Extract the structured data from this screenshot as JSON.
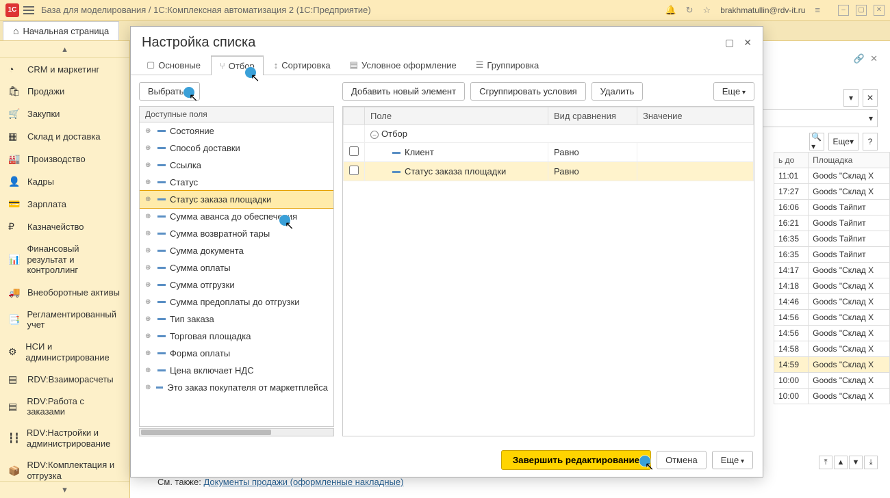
{
  "titlebar": {
    "title": "База для моделирования / 1С:Комплексная автоматизация 2  (1С:Предприятие)",
    "user": "brakhmatullin@rdv-it.ru"
  },
  "start_tab": "Начальная страница",
  "sidebar": {
    "items": [
      {
        "icon": "◔",
        "label": "CRM и маркетинг"
      },
      {
        "icon": "🛍",
        "label": "Продажи"
      },
      {
        "icon": "🛒",
        "label": "Закупки"
      },
      {
        "icon": "▦",
        "label": "Склад и доставка"
      },
      {
        "icon": "🏭",
        "label": "Производство"
      },
      {
        "icon": "👤",
        "label": "Кадры"
      },
      {
        "icon": "💳",
        "label": "Зарплата"
      },
      {
        "icon": "₽",
        "label": "Казначейство"
      },
      {
        "icon": "📊",
        "label": "Финансовый результат и контроллинг"
      },
      {
        "icon": "🚚",
        "label": "Внеоборотные активы"
      },
      {
        "icon": "📑",
        "label": "Регламентированный учет"
      },
      {
        "icon": "⚙",
        "label": "НСИ и администрирование"
      },
      {
        "icon": "▤",
        "label": "RDV:Взаиморасчеты"
      },
      {
        "icon": "▤",
        "label": "RDV:Работа с заказами"
      },
      {
        "icon": "┇┇",
        "label": "RDV:Настройки и администрирование"
      },
      {
        "icon": "📦",
        "label": "RDV:Комплектация и отгрузка"
      }
    ]
  },
  "bg_toolbar": {
    "more": "Еще",
    "help": "?"
  },
  "bg_table": {
    "headers": {
      "col1": "ь до",
      "col2": "Площадка"
    },
    "rows": [
      {
        "c1": "11:01",
        "c2": "Goods \"Склад X"
      },
      {
        "c1": "17:27",
        "c2": "Goods \"Склад X"
      },
      {
        "c1": "16:06",
        "c2": "Goods Тайпит"
      },
      {
        "c1": "16:21",
        "c2": "Goods Тайпит"
      },
      {
        "c1": "16:35",
        "c2": "Goods Тайпит"
      },
      {
        "c1": "16:35",
        "c2": "Goods Тайпит"
      },
      {
        "c1": "14:17",
        "c2": "Goods \"Склад X"
      },
      {
        "c1": "14:18",
        "c2": "Goods \"Склад X"
      },
      {
        "c1": "14:46",
        "c2": "Goods \"Склад X"
      },
      {
        "c1": "14:56",
        "c2": "Goods \"Склад X"
      },
      {
        "c1": "14:56",
        "c2": "Goods \"Склад X"
      },
      {
        "c1": "14:58",
        "c2": "Goods \"Склад X"
      },
      {
        "c1": "14:59",
        "c2": "Goods \"Склад X",
        "hl": true
      },
      {
        "c1": "10:00",
        "c2": "Goods \"Склад X"
      },
      {
        "c1": "10:00",
        "c2": "Goods \"Склад X"
      }
    ]
  },
  "footer": {
    "prefix": "См. также: ",
    "link": "Документы продажи (оформленные накладные)"
  },
  "dialog": {
    "title": "Настройка списка",
    "tabs": {
      "main": "Основные",
      "filter": "Отбор",
      "sort": "Сортировка",
      "cond": "Условное оформление",
      "group": "Группировка"
    },
    "buttons": {
      "choose": "Выбрать...",
      "add_element": "Добавить новый элемент",
      "group_cond": "Сгруппировать условия",
      "delete": "Удалить",
      "more": "Еще",
      "finish": "Завершить редактирование",
      "cancel": "Отмена"
    },
    "available_fields_header": "Доступные поля",
    "available_fields": [
      "Состояние",
      "Способ доставки",
      "Ссылка",
      "Статус",
      "Статус заказа площадки",
      "Сумма аванса до обеспечения",
      "Сумма возвратной тары",
      "Сумма документа",
      "Сумма оплаты",
      "Сумма отгрузки",
      "Сумма предоплаты до отгрузки",
      "Тип заказа",
      "Торговая площадка",
      "Форма оплаты",
      "Цена включает НДС",
      "Это заказ покупателя от маркетплейса"
    ],
    "selected_field_index": 4,
    "filter_headers": {
      "field": "Поле",
      "compare": "Вид сравнения",
      "value": "Значение"
    },
    "filter_root": "Отбор",
    "filter_rows": [
      {
        "field": "Клиент",
        "compare": "Равно",
        "value": ""
      },
      {
        "field": "Статус заказа площадки",
        "compare": "Равно",
        "value": ""
      }
    ]
  }
}
